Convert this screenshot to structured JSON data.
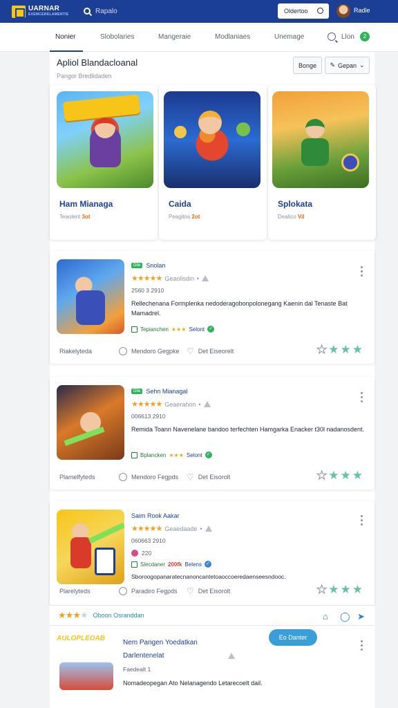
{
  "header": {
    "logo_text": "UARNAR",
    "logo_sub": "EXEMCERELAMENTIE",
    "search_placeholder": "Rapalo",
    "pill_label": "Oldertoo",
    "user_label": "Radle"
  },
  "nav": {
    "tabs": [
      "Nonier",
      "Slobolaries",
      "Mangeraie",
      "Modlaniaes",
      "Unemage"
    ],
    "user": "Llon",
    "badge": "2"
  },
  "section": {
    "title": "Apliol Blandacloanal",
    "subtitle": "Pangor Bredlidaden",
    "button_1": "Bonge",
    "button_2": "Gepan"
  },
  "cards": [
    {
      "title": "Ham Mianaga",
      "meta": "Teaolent",
      "meta_highlight": "3ot"
    },
    {
      "title": "Caida",
      "meta": "Peagitos",
      "meta_highlight": "2ot"
    },
    {
      "title": "Splokata",
      "meta": "Dealico",
      "meta_highlight": "Vil"
    }
  ],
  "items": [
    {
      "badge": "Dile",
      "title": "Snolan",
      "rating_text": "Geaolisdin",
      "date": "2560 3 2910",
      "desc": "Rellechenana Formplenka nedoderagobonpolonegang Kaenin dal Tenaste Bat Mamadrel.",
      "status": "Tepianchen",
      "status_extra": "Selont",
      "foot_a": "Riakelyteda",
      "foot_b": "Mendoro Gegpke",
      "foot_c": "Det Eiseorelt"
    },
    {
      "badge": "Dile",
      "title": "Sehn Mianagal",
      "rating_text": "Geaerahon",
      "date": "006613 2910",
      "desc": "Remida Toann Navenelane bandoo terfechten Hamgarka Enacker t30l nadanosdent.",
      "status": "Bplancken",
      "status_extra": "Selont",
      "foot_a": "Plamelfyteds",
      "foot_b": "Mendoro Fegpds",
      "foot_c": "Det Eisorolt"
    },
    {
      "title": "Saim Rook Aakar",
      "rating_text": "Geaedaade",
      "date": "060663 2910",
      "extra": "220",
      "desc": "Sboroogopanaratecnanoncantetoaoccoeredaenseesndooc.",
      "status": "Slecdaner",
      "status_hl": "200fk",
      "status_extra": "Belens",
      "foot_a": "Plarelyteds",
      "foot_b": "Paradiro Fegpds",
      "foot_c": "Det Eisorolt"
    }
  ],
  "strip": {
    "label": "Oboon Osranddan"
  },
  "last": {
    "logo": "AULOPLEOAB",
    "title": "Nem Pangen Yoedatkan",
    "subtitle": "Darlentenelat",
    "meta": "Faedealt 1",
    "desc": "Nomadeopegan Ato Nelanagendo Letarecoelt dail.",
    "cta": "Eo Danter"
  },
  "colors": {
    "brand": "#1b3f94",
    "accent": "#f7c51a",
    "success": "#2fb45a",
    "star": "#f4a11a"
  }
}
